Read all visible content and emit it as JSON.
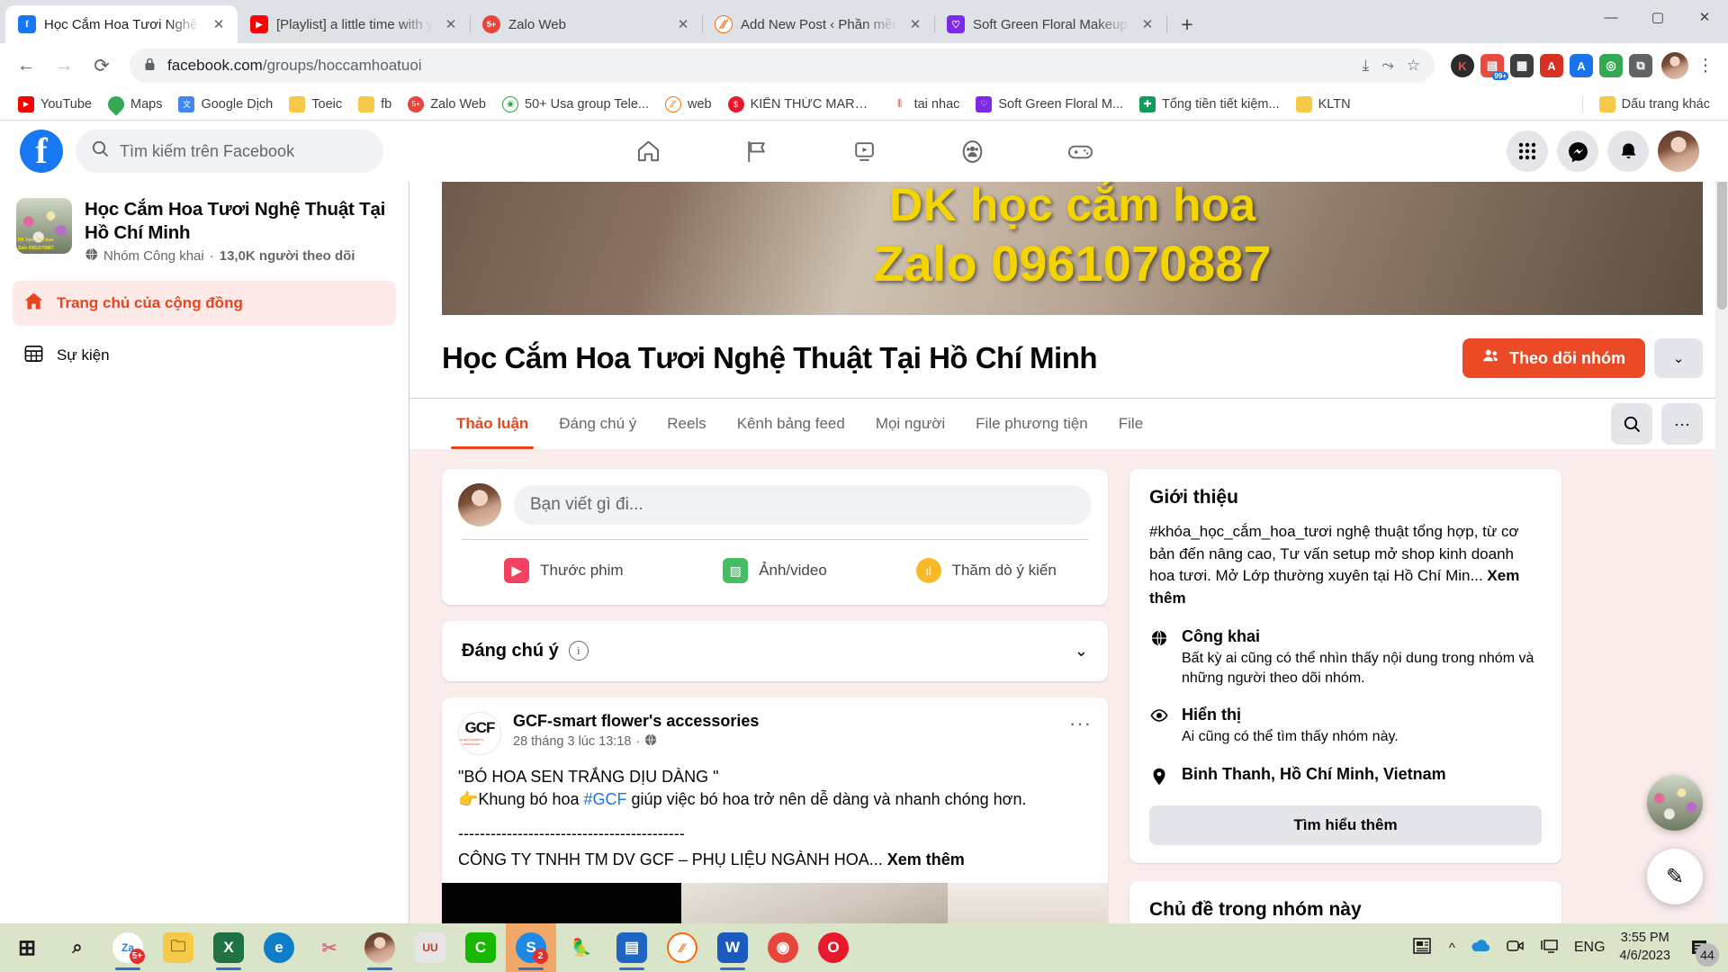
{
  "browser": {
    "tabs": [
      {
        "title": "Học Cắm Hoa Tươi Nghệ Thuật T",
        "favicon": "facebook-icon",
        "color": "#1877f2",
        "glyph": "f",
        "active": true
      },
      {
        "title": "[Playlist] a little time with yourself",
        "favicon": "youtube-icon",
        "color": "#ff0000",
        "glyph": "▶",
        "active": false
      },
      {
        "title": "Zalo Web",
        "favicon": "zalo-icon",
        "color": "#0068ff",
        "glyph": "5+",
        "active": false
      },
      {
        "title": "Add New Post ‹ Phần mềm Bán h",
        "favicon": "wordpress-icon",
        "color": "#ff6a00",
        "glyph": "W",
        "active": false
      },
      {
        "title": "Soft Green Floral Makeup Beauty",
        "favicon": "canva-icon",
        "color": "#7d2ae8",
        "glyph": "♡",
        "active": false
      }
    ],
    "new_tab_label": "+",
    "window_controls": {
      "minimize": "—",
      "maximize": "▢",
      "close": "✕"
    },
    "nav": {
      "back": "←",
      "forward": "→",
      "reload": "⟳"
    },
    "omnibox": {
      "lock": "🔒",
      "domain": "facebook.com",
      "path": "/groups/hoccamhoatuoi",
      "install_icon": "install-icon",
      "share_icon": "share-icon",
      "bookmark_icon": "star-icon"
    },
    "extensions": [
      {
        "name": "kami-extension",
        "glyph": "K",
        "color": "#2b2b2b",
        "badge": ""
      },
      {
        "name": "shopping-extension",
        "glyph": "",
        "color": "#e84a40",
        "badge": "99+"
      },
      {
        "name": "qr-extension",
        "glyph": "▦",
        "color": "#3c4043",
        "badge": ""
      },
      {
        "name": "grammarly-extension",
        "glyph": "A",
        "color": "#d93025",
        "badge": ""
      },
      {
        "name": "adobe-extension",
        "glyph": "A",
        "color": "#1a73e8",
        "badge": ""
      },
      {
        "name": "shield-extension",
        "glyph": "◎",
        "color": "#34a853",
        "badge": ""
      },
      {
        "name": "puzzle-extension",
        "glyph": "🧩",
        "color": "#5f6368",
        "badge": ""
      }
    ],
    "profile_icon": "profile-avatar",
    "menu_icon": "⋮",
    "bookmarks": [
      {
        "label": "YouTube",
        "icon": "youtube-icon",
        "color": "#ff0000",
        "glyph": "▶"
      },
      {
        "label": "Maps",
        "icon": "maps-icon",
        "color": "#34a853",
        "glyph": "◉"
      },
      {
        "label": "Google Dịch",
        "icon": "translate-icon",
        "color": "#4285f4",
        "glyph": "文"
      },
      {
        "label": "Toeic",
        "icon": "folder-icon",
        "color": "#f7c948",
        "glyph": ""
      },
      {
        "label": "fb",
        "icon": "folder-icon",
        "color": "#f7c948",
        "glyph": ""
      },
      {
        "label": "Zalo Web",
        "icon": "zalo-icon",
        "color": "#e8453c",
        "glyph": "5+"
      },
      {
        "label": "50+ Usa group Tele...",
        "icon": "telegram-icon",
        "color": "#2aa53f",
        "glyph": "◎"
      },
      {
        "label": "web",
        "icon": "wordpress-icon",
        "color": "#ff6a00",
        "glyph": "W"
      },
      {
        "label": "KIẾN THỨC MARKE...",
        "icon": "diamond-icon",
        "color": "#e8192c",
        "glyph": "◆"
      },
      {
        "label": "tai nhac",
        "icon": "music-icon",
        "color": "#e8453c",
        "glyph": "♫"
      },
      {
        "label": "Soft Green Floral M...",
        "icon": "canva-icon",
        "color": "#7d2ae8",
        "glyph": "♡"
      },
      {
        "label": "Tổng tiền tiết kiệm...",
        "icon": "sheets-icon",
        "color": "#0f9d58",
        "glyph": "✚"
      },
      {
        "label": "KLTN",
        "icon": "folder-icon",
        "color": "#f7c948",
        "glyph": ""
      }
    ],
    "other_bookmarks": {
      "label": "Dấu trang khác",
      "icon": "folder-icon"
    }
  },
  "facebook": {
    "logo": "f",
    "search": {
      "placeholder": "Tìm kiếm trên Facebook",
      "icon": "search-icon"
    },
    "nav_icons": [
      {
        "name": "home-icon",
        "glyph": "⌂"
      },
      {
        "name": "pages-icon",
        "glyph": "⚑"
      },
      {
        "name": "watch-icon",
        "glyph": "▣"
      },
      {
        "name": "groups-icon",
        "glyph": "◍"
      },
      {
        "name": "gaming-icon",
        "glyph": "▭"
      }
    ],
    "right_icons": [
      {
        "name": "menu-grid-icon",
        "glyph": "⠿"
      },
      {
        "name": "messenger-icon",
        "glyph": "✆"
      },
      {
        "name": "notifications-icon",
        "glyph": "🔔"
      }
    ],
    "account_avatar": "user-avatar",
    "sidebar": {
      "group_name": "Học Cắm Hoa Tươi Nghệ Thuật Tại Hồ Chí Minh",
      "group_privacy": "Nhóm Công khai",
      "group_separator": "·",
      "group_followers": "13,0K người theo dõi",
      "privacy_icon": "globe-icon",
      "items": [
        {
          "label": "Trang chủ của cộng đồng",
          "icon": "home-icon",
          "active": true
        },
        {
          "label": "Sự kiện",
          "icon": "calendar-icon",
          "active": false
        }
      ]
    },
    "cover": {
      "line1": "DK học cắm hoa",
      "line2": "Zalo 0961070887"
    },
    "group": {
      "title": "Học Cắm Hoa Tươi Nghệ Thuật Tại Hồ Chí Minh",
      "follow_button": "Theo dõi nhóm",
      "follow_icon": "people-icon",
      "more_chevron": "⌄",
      "accent_color": "#eb4a26"
    },
    "tabs": [
      {
        "label": "Thảo luận",
        "active": true
      },
      {
        "label": "Đáng chú ý",
        "active": false
      },
      {
        "label": "Reels",
        "active": false
      },
      {
        "label": "Kênh bảng feed",
        "active": false
      },
      {
        "label": "Mọi người",
        "active": false
      },
      {
        "label": "File phương tiện",
        "active": false
      },
      {
        "label": "File",
        "active": false
      }
    ],
    "tab_actions": [
      {
        "name": "search-button",
        "glyph": "🔍"
      },
      {
        "name": "more-options-button",
        "glyph": "···"
      }
    ],
    "composer": {
      "placeholder": "Bạn viết gì đi...",
      "avatar": "user-avatar",
      "actions": [
        {
          "label": "Thước phim",
          "icon": "reels-icon",
          "color": "#f3425f",
          "glyph": "▶"
        },
        {
          "label": "Ảnh/video",
          "icon": "photo-video-icon",
          "color": "#45bd62",
          "glyph": "🖼"
        },
        {
          "label": "Thăm dò ý kiến",
          "icon": "poll-icon",
          "color": "#f7b928",
          "glyph": "ıl"
        }
      ]
    },
    "notice": {
      "title": "Đáng chú ý",
      "info_icon": "i",
      "chevron": "⌄"
    },
    "post": {
      "author": "GCF-smart flower's accessories",
      "avatar_text": "GCF",
      "avatar_sub": "smart flower's accessories",
      "timestamp": "28 tháng 3 lúc 13:18",
      "separator": "·",
      "privacy_icon": "globe-icon",
      "menu_icon": "···",
      "line1": "\"BÓ HOA SEN TRẮNG DỊU DÀNG \"",
      "line2_prefix": "👉Khung bó hoa ",
      "line2_hashtag": "#GCF",
      "line2_suffix": " giúp việc bó hoa trở nên dễ dàng và nhanh chóng hơn.",
      "line3": "------------------------------------------",
      "line4": "CÔNG TY TNHH TM DV GCF – PHỤ LIỆU NGÀNH HOA...",
      "see_more": "Xem thêm"
    },
    "about": {
      "heading": "Giới thiệu",
      "description": "#khóa_học_cắm_hoa_tươi nghệ thuật tổng hợp, từ cơ bản đến nâng cao, Tư vấn setup mở shop kinh doanh hoa tươi. Mở Lớp thường xuyên tại Hồ Chí Min...",
      "see_more": "Xem thêm",
      "rows": [
        {
          "icon": "globe-icon",
          "glyph": "🌐",
          "title": "Công khai",
          "subtitle": "Bất kỳ ai cũng có thể nhìn thấy nội dung trong nhóm và những người theo dõi nhóm."
        },
        {
          "icon": "eye-icon",
          "glyph": "👁",
          "title": "Hiển thị",
          "subtitle": "Ai cũng có thể tìm thấy nhóm này."
        },
        {
          "icon": "location-pin-icon",
          "glyph": "📍",
          "title": "Binh Thanh, Hồ Chí Minh, Vietnam",
          "subtitle": ""
        }
      ],
      "learn_more": "Tìm hiểu thêm"
    },
    "topics": {
      "heading": "Chủ đề trong nhóm này"
    },
    "floating": {
      "chat_avatar": "chat-avatar",
      "write_icon": "✎"
    }
  },
  "taskbar": {
    "items": [
      {
        "name": "start-button",
        "glyph": "⊞",
        "color": "transparent",
        "text": "#1b1b1b",
        "running": false
      },
      {
        "name": "search-button",
        "glyph": "🔍",
        "color": "transparent",
        "text": "#1b1b1b",
        "running": false
      },
      {
        "name": "zalo-taskbar",
        "glyph": "Za",
        "color": "#1e88e5",
        "badge": "5+",
        "running": true
      },
      {
        "name": "file-explorer",
        "glyph": "🗀",
        "color": "#f7c948",
        "running": false
      },
      {
        "name": "excel",
        "glyph": "X",
        "color": "#1f7244",
        "running": true
      },
      {
        "name": "edge",
        "glyph": "e",
        "color": "#0f7ec8",
        "running": false
      },
      {
        "name": "snipping-tool",
        "glyph": "✂",
        "color": "#e0e0e0",
        "running": false
      },
      {
        "name": "chrome-1",
        "glyph": "◉",
        "color": "#e8453c",
        "running": true
      },
      {
        "name": "unikey",
        "glyph": "U",
        "color": "#d9d9d9",
        "running": false
      },
      {
        "name": "line-app",
        "glyph": "C",
        "color": "#19b800",
        "running": false
      },
      {
        "name": "skype",
        "glyph": "S",
        "color": "#1e88e5",
        "badge": "2",
        "running": true,
        "highlight": true
      },
      {
        "name": "bird-app",
        "glyph": "🦜",
        "color": "#5cc24a",
        "running": false
      },
      {
        "name": "teamviewer",
        "glyph": "🖵",
        "color": "#1e66c4",
        "running": true
      },
      {
        "name": "wordpress-app",
        "glyph": "W",
        "color": "#ff6a00",
        "running": false
      },
      {
        "name": "word",
        "glyph": "W",
        "color": "#1b5bbf",
        "running": true
      },
      {
        "name": "chrome-2",
        "glyph": "◉",
        "color": "#e8453c",
        "running": false
      },
      {
        "name": "opera",
        "glyph": "O",
        "color": "#e8192c",
        "running": false
      }
    ],
    "tray": {
      "news_icon": "news-icon",
      "chevron_icon": "^",
      "onedrive_icon": "☁",
      "camera_icon": "📹",
      "network_icon": "🖥",
      "language": "ENG",
      "time": "3:55 PM",
      "date": "4/6/2023",
      "notification_icon": "notification-icon",
      "notification_count": "44"
    }
  }
}
